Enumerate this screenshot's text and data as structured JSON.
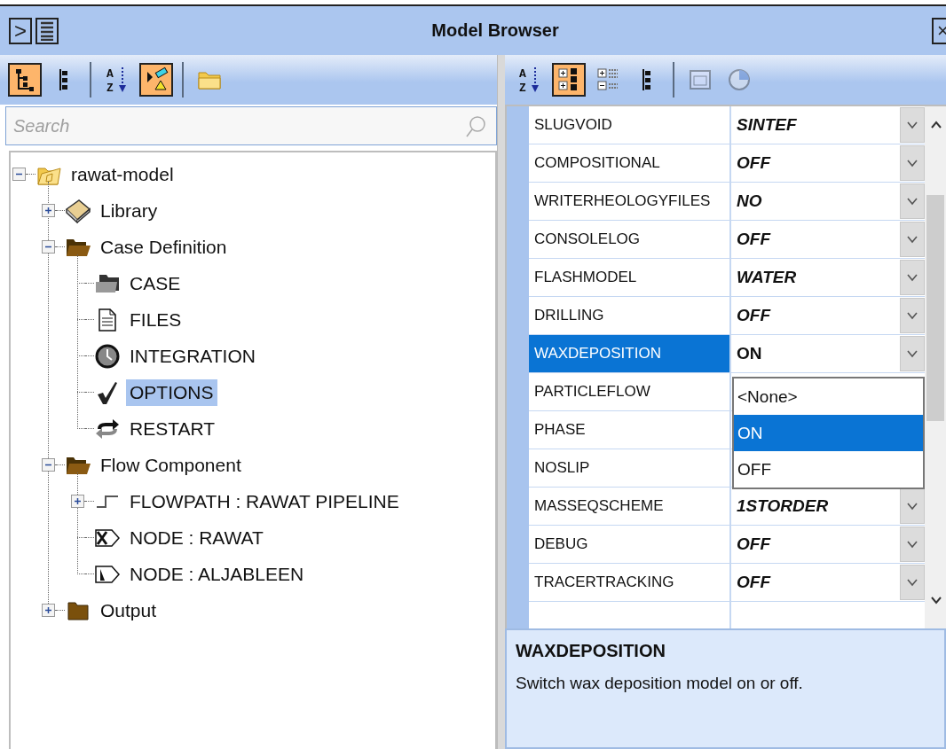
{
  "window": {
    "title": "Model Browser",
    "left_buttons": [
      {
        "kind": "expand",
        "label": ">"
      },
      {
        "kind": "menu"
      }
    ],
    "close": "×"
  },
  "left_toolbar": [
    {
      "kind": "tree-view",
      "selected": true
    },
    {
      "kind": "list-view",
      "selected": false
    },
    {
      "kind": "separator"
    },
    {
      "kind": "sort",
      "letters": [
        "A",
        "Z"
      ],
      "selected": false
    },
    {
      "kind": "filter",
      "selected": true
    },
    {
      "kind": "separator"
    },
    {
      "kind": "folder",
      "selected": false
    }
  ],
  "search": {
    "placeholder": "Search"
  },
  "tree": [
    {
      "label": "rawat-model",
      "kind": "model",
      "expanded": true,
      "selected": false,
      "children": [
        {
          "label": "Library",
          "kind": "book",
          "expanded": false,
          "selected": false
        },
        {
          "label": "Case Definition",
          "kind": "folder-open",
          "expanded": true,
          "selected": false,
          "children": [
            {
              "label": "CASE",
              "kind": "case",
              "selected": false
            },
            {
              "label": "FILES",
              "kind": "file",
              "selected": false
            },
            {
              "label": "INTEGRATION",
              "kind": "clock",
              "selected": false
            },
            {
              "label": "OPTIONS",
              "kind": "check",
              "selected": true
            },
            {
              "label": "RESTART",
              "kind": "restart",
              "selected": false
            }
          ]
        },
        {
          "label": "Flow Component",
          "kind": "folder-open",
          "expanded": true,
          "selected": false,
          "children": [
            {
              "label": "FLOWPATH : RAWAT PIPELINE",
              "kind": "flowpath",
              "expanded": false,
              "selected": false
            },
            {
              "label": "NODE : RAWAT",
              "kind": "node-closed",
              "selected": false
            },
            {
              "label": "NODE : ALJABLEEN",
              "kind": "node-open",
              "selected": false
            }
          ]
        },
        {
          "label": "Output",
          "kind": "folder",
          "expanded": false,
          "selected": false
        }
      ]
    }
  ],
  "right_toolbar": [
    {
      "kind": "sort",
      "letters": [
        "A",
        "Z"
      ],
      "selected": false,
      "disabled": false
    },
    {
      "kind": "categorized",
      "selected": true,
      "disabled": false
    },
    {
      "kind": "expanded",
      "selected": false,
      "disabled": false
    },
    {
      "kind": "list-view",
      "selected": false,
      "disabled": false
    },
    {
      "kind": "separator"
    },
    {
      "kind": "window",
      "selected": false,
      "disabled": true
    },
    {
      "kind": "pie",
      "selected": false,
      "disabled": true
    }
  ],
  "properties": [
    {
      "name": "SLUGVOID",
      "value": "SINTEF",
      "selected": false
    },
    {
      "name": "COMPOSITIONAL",
      "value": "OFF",
      "selected": false
    },
    {
      "name": "WRITERHEOLOGYFILES",
      "value": "NO",
      "selected": false
    },
    {
      "name": "CONSOLELOG",
      "value": "OFF",
      "selected": false
    },
    {
      "name": "FLASHMODEL",
      "value": "WATER",
      "selected": false
    },
    {
      "name": "DRILLING",
      "value": "OFF",
      "selected": false
    },
    {
      "name": "WAXDEPOSITION",
      "value": "ON",
      "selected": true
    },
    {
      "name": "PARTICLEFLOW",
      "selected": false
    },
    {
      "name": "PHASE",
      "selected": false
    },
    {
      "name": "NOSLIP",
      "selected": false
    },
    {
      "name": "MASSEQSCHEME",
      "value": "1STORDER",
      "selected": false
    },
    {
      "name": "DEBUG",
      "value": "OFF",
      "selected": false
    },
    {
      "name": "TRACERTRACKING",
      "value": "OFF",
      "selected": false
    }
  ],
  "dropdown": {
    "options": [
      {
        "label": "<None>",
        "selected": false
      },
      {
        "label": "ON",
        "selected": true
      },
      {
        "label": "OFF",
        "selected": false
      }
    ]
  },
  "description": {
    "title": "WAXDEPOSITION",
    "text": "Switch wax deposition model on or off."
  }
}
